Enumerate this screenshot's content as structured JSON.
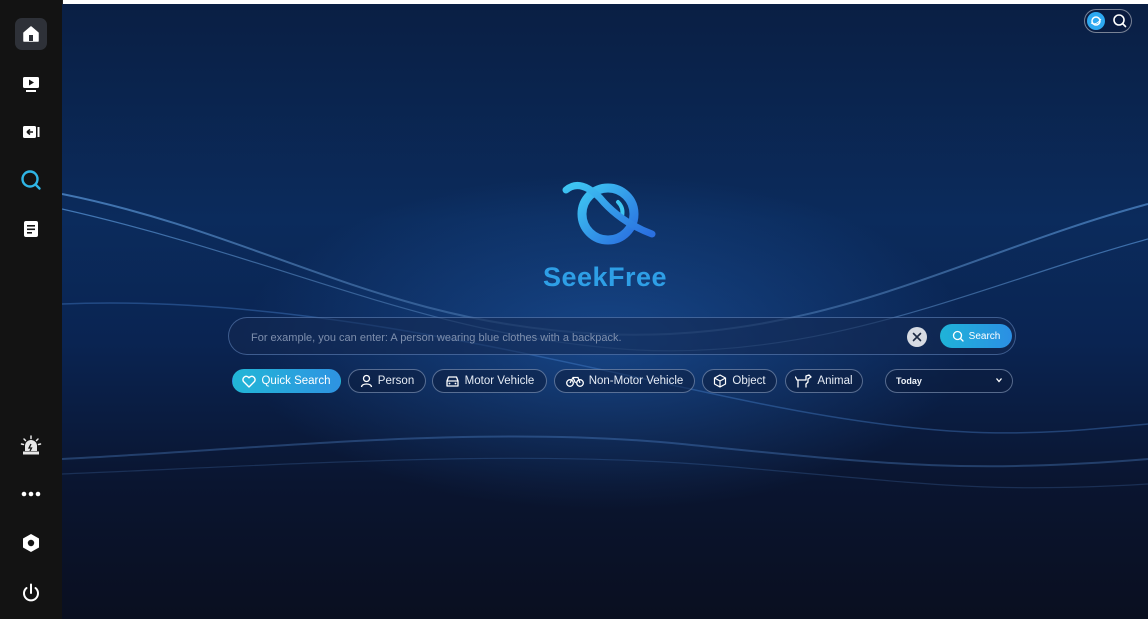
{
  "sidebar": {
    "items": [
      {
        "name": "home",
        "icon": "home-icon",
        "active": true
      },
      {
        "name": "playback",
        "icon": "play-screen-icon"
      },
      {
        "name": "video-export",
        "icon": "video-return-icon"
      },
      {
        "name": "search",
        "icon": "search-icon",
        "highlighted": true
      },
      {
        "name": "logs",
        "icon": "document-icon"
      }
    ],
    "bottom": [
      {
        "name": "alarm",
        "icon": "alarm-light-icon"
      },
      {
        "name": "more",
        "icon": "more-dots-icon"
      },
      {
        "name": "settings",
        "icon": "hexagon-settings-icon"
      },
      {
        "name": "power",
        "icon": "power-icon"
      }
    ]
  },
  "brand": {
    "name": "SeekFree",
    "color": "#2e9fe6"
  },
  "search": {
    "placeholder": "For example, you can enter: A person wearing blue clothes with a backpack.",
    "value": "",
    "button_label": "Search",
    "clear_icon": "close-icon"
  },
  "filters": [
    {
      "label": "Quick Search",
      "icon": "heart-icon",
      "active": true
    },
    {
      "label": "Person",
      "icon": "person-icon"
    },
    {
      "label": "Motor Vehicle",
      "icon": "car-icon"
    },
    {
      "label": "Non-Motor Vehicle",
      "icon": "bicycle-icon"
    },
    {
      "label": "Object",
      "icon": "cube-icon"
    },
    {
      "label": "Animal",
      "icon": "dog-icon"
    }
  ],
  "time_filter": {
    "selected": "Today"
  },
  "colors": {
    "accent": "#2e9fe6",
    "sidebar": "#131313",
    "background": "#0b2b5c"
  }
}
